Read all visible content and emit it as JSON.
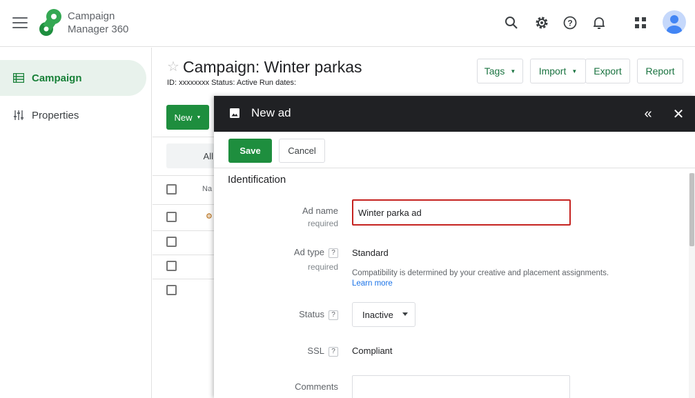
{
  "app": {
    "name_line1": "Campaign",
    "name_line2": "Manager 360"
  },
  "topbar": {
    "icons": [
      "search-icon",
      "settings-icon",
      "help-icon",
      "notifications-icon",
      "apps-icon",
      "account-icon"
    ]
  },
  "nav": {
    "items": [
      {
        "label": "Campaign",
        "icon": "list-icon",
        "active": true
      },
      {
        "label": "Properties",
        "icon": "sliders-icon",
        "active": false
      }
    ]
  },
  "campaign": {
    "title": "Campaign: Winter parkas",
    "meta": "ID: xxxxxxxx Status: Active  Run dates:"
  },
  "toolbar": {
    "tags": "Tags",
    "import": "Import",
    "export": "Export",
    "report": "Report",
    "new": "New"
  },
  "table": {
    "filter_all": "All",
    "col_name": "Na"
  },
  "panel": {
    "title": "New ad",
    "save": "Save",
    "cancel": "Cancel",
    "section": "Identification",
    "fields": {
      "ad_name": {
        "label": "Ad name",
        "sub": "required",
        "value": "Winter parka ad"
      },
      "ad_type": {
        "label": "Ad type",
        "sub": "required",
        "value": "Standard",
        "help": "Compatibility is determined by your creative and placement assignments.",
        "link": "Learn more"
      },
      "status": {
        "label": "Status",
        "value": "Inactive"
      },
      "ssl": {
        "label": "SSL",
        "value": "Compliant"
      },
      "comments": {
        "label": "Comments",
        "value": ""
      }
    },
    "help_glyph": "?"
  },
  "colors": {
    "accent": "#1e8e3e",
    "header": "#202124",
    "error": "#c5221f",
    "link": "#1a73e8"
  }
}
